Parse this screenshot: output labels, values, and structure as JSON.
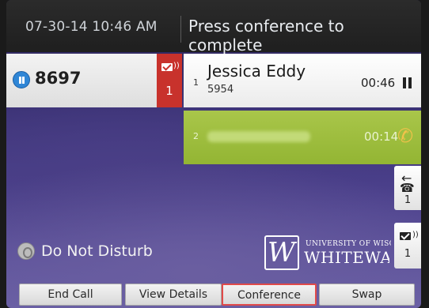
{
  "header": {
    "datetime": "07-30-14 10:46 AM",
    "prompt": "Press conference to complete"
  },
  "line_key": {
    "extension": "8697",
    "voicemail_count": "1",
    "status_icon": "pause-icon"
  },
  "calls": [
    {
      "index": "1",
      "name": "Jessica Eddy",
      "number": "5954",
      "timer": "00:46",
      "state_icon": "hold-icon"
    },
    {
      "index": "2",
      "name": "",
      "timer": "00:14",
      "state_icon": "phone-ringing-icon"
    }
  ],
  "side_keys": {
    "transfer_count": "1",
    "voicemail_count": "1"
  },
  "status": {
    "dnd_label": "Do Not Disturb"
  },
  "logo": {
    "top": "UNIVERSITY OF WISCONSIN",
    "bottom": "WHITEWATER"
  },
  "softkeys": {
    "end_call": "End Call",
    "view_details": "View Details",
    "conference": "Conference",
    "swap": "Swap"
  },
  "colors": {
    "voicemail_badge": "#c8322c",
    "active_call": "#a9c64a",
    "highlight": "#e14a49",
    "accent_blue": "#2f86d6"
  }
}
